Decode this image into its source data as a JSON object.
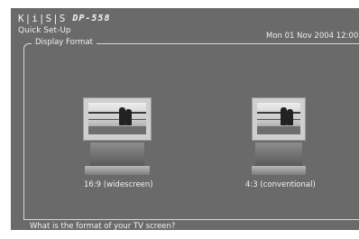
{
  "header": {
    "brand": "K|i|S|S",
    "model": "DP-558",
    "subtitle": "Quick Set-Up",
    "datetime": "Mon 01 Nov 2004 12:00"
  },
  "section": {
    "legend": "Display Format"
  },
  "options": [
    {
      "label": "16:9 (widescreen)",
      "icon": "widescreen-tv-icon"
    },
    {
      "label": "4:3 (conventional)",
      "icon": "conventional-tv-icon"
    }
  ],
  "status": {
    "question": "What is the format of your TV screen?"
  },
  "colors": {
    "panel": "#6a6a6a",
    "text": "#f2f2f2",
    "frame": "#d8d8d8"
  }
}
